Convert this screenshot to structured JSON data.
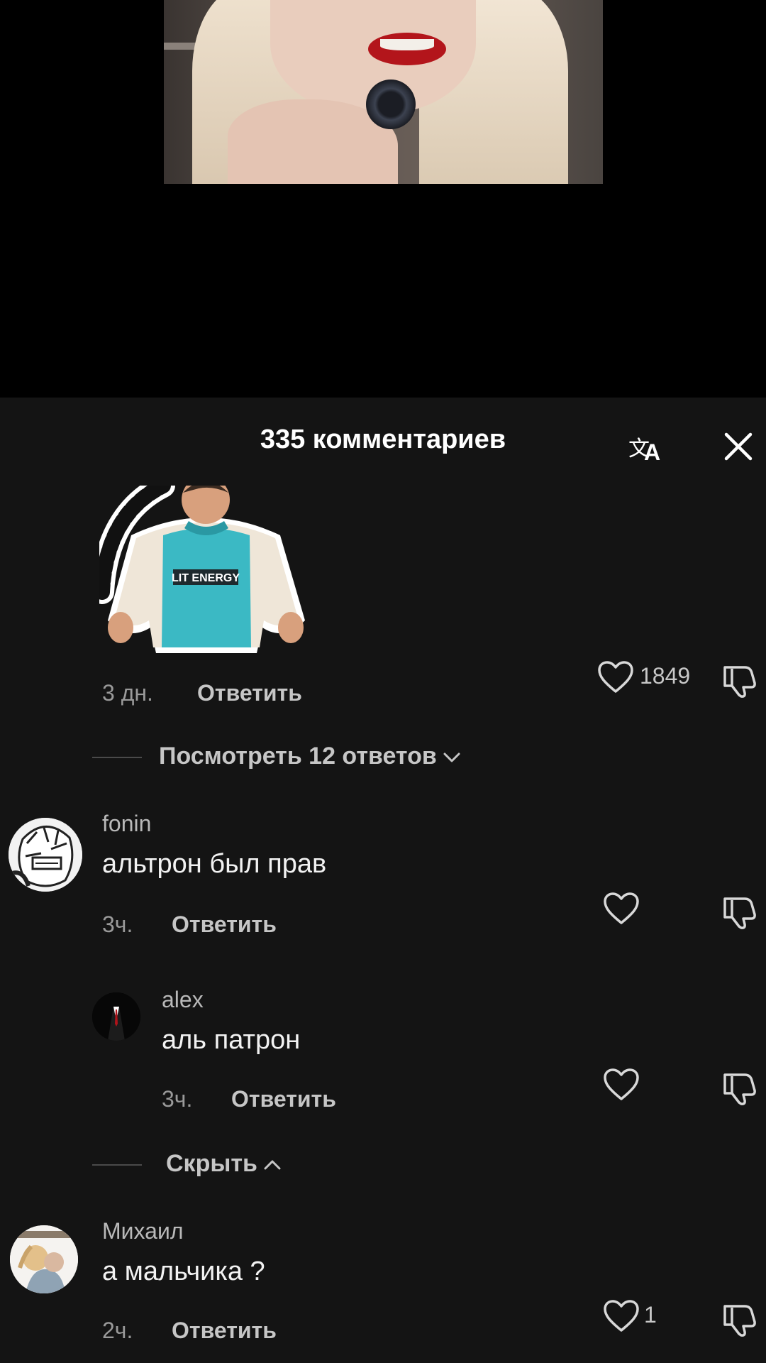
{
  "header": {
    "title": "335 комментариев"
  },
  "top_comment": {
    "time": "3 дн.",
    "reply_label": "Ответить",
    "likes": "1849",
    "sticker_text": "LIT ENERGY"
  },
  "thread": {
    "view_replies_label": "Посмотреть 12 ответов",
    "hide_label": "Скрыть"
  },
  "comments": [
    {
      "username": "fonin",
      "text": "альтрон был прав",
      "time": "3ч.",
      "reply_label": "Ответить",
      "likes": ""
    },
    {
      "username": "alex",
      "text": "аль патрон",
      "time": "3ч.",
      "reply_label": "Ответить",
      "likes": ""
    },
    {
      "username": "Михаил",
      "text": "а мальчика ?",
      "time": "2ч.",
      "reply_label": "Ответить",
      "likes": "1"
    }
  ],
  "icons": {
    "translate": "translate-icon",
    "close": "close-icon",
    "like": "heart-icon",
    "dislike": "thumbs-down-icon",
    "chevron_down": "chevron-down-icon",
    "chevron_up": "chevron-up-icon"
  },
  "colors": {
    "sheet_bg": "#141414",
    "text_secondary": "#9a9a9a",
    "text_primary": "#ffffff"
  }
}
